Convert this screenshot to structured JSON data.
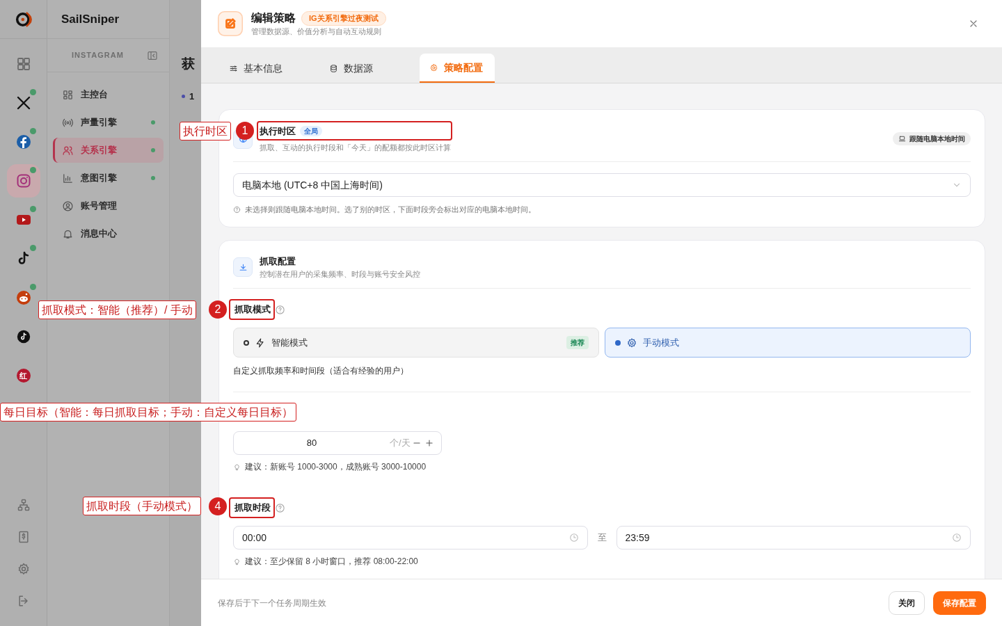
{
  "app": {
    "brand": "SailSniper"
  },
  "platform_rail": [
    {
      "kind": "grid",
      "selected": false,
      "online": false
    },
    {
      "kind": "x",
      "selected": false,
      "online": true
    },
    {
      "kind": "facebook",
      "selected": false,
      "online": true
    },
    {
      "kind": "instagram",
      "selected": true,
      "online": true
    },
    {
      "kind": "youtube",
      "selected": false,
      "online": true
    },
    {
      "kind": "tiktok",
      "selected": false,
      "online": true
    },
    {
      "kind": "reddit",
      "selected": false,
      "online": true
    },
    {
      "kind": "tiktok",
      "selected": false,
      "online": false
    },
    {
      "kind": "badge",
      "label": "红",
      "selected": false,
      "online": false
    }
  ],
  "sidebar": {
    "section": "INSTAGRAM",
    "items": [
      {
        "kind": "dashboard",
        "label": "主控台",
        "selected": false,
        "online": false
      },
      {
        "kind": "signal",
        "label": "声量引擎",
        "selected": false,
        "online": true
      },
      {
        "kind": "users",
        "label": "关系引擎",
        "selected": true,
        "online": true
      },
      {
        "kind": "chart",
        "label": "意图引擎",
        "selected": false,
        "online": true
      },
      {
        "kind": "account",
        "label": "账号管理",
        "selected": false,
        "online": false
      },
      {
        "kind": "bell",
        "label": "消息中心",
        "selected": false,
        "online": false
      }
    ]
  },
  "background_page": {
    "heading": "获",
    "step": "1"
  },
  "drawer": {
    "title": "编辑策略",
    "tag": "IG关系引擎过夜测试",
    "subtitle": "管理数据源、价值分析与自动互动规则",
    "tabs": [
      {
        "kind": "sliders",
        "label": "基本信息",
        "selected": false
      },
      {
        "kind": "database",
        "label": "数据源",
        "selected": false
      },
      {
        "kind": "gear",
        "label": "策略配置",
        "selected": true
      }
    ],
    "timezone_card": {
      "title": "执行时区",
      "scope": "全局",
      "subtitle": "抓取、互动的执行时段和「今天」的配额都按此时区计算",
      "pill": "跟随电脑本地时间",
      "select_value": "电脑本地 (UTC+8 中国上海时间)",
      "help": "未选择则跟随电脑本地时间。选了别的时区，下面时段旁会标出对应的电脑本地时间。"
    },
    "crawl_card": {
      "title": "抓取配置",
      "subtitle": "控制潜在用户的采集频率、时段与账号安全风控",
      "mode_label": "抓取模式",
      "modes": [
        {
          "kind": "smart",
          "label": "智能模式",
          "badge": "推荐",
          "selected": false
        },
        {
          "kind": "manual",
          "label": "手动模式",
          "selected": true
        }
      ],
      "mode_description": "自定义抓取频率和时间段（适合有经验的用户）",
      "daily_target": {
        "value": "80",
        "unit": "个/天",
        "tip": "建议：新账号 1000-3000，成熟账号 3000-10000"
      },
      "period_label": "抓取时段",
      "period_start": "00:00",
      "period_separator": "至",
      "period_end": "23:59",
      "period_tip": "建议：至少保留 8 小时窗口，推荐 08:00-22:00"
    },
    "footer_note": "保存后于下一个任务周期生效",
    "close_button": "关闭",
    "save_button": "保存配置"
  },
  "annotations": [
    {
      "text": "执行时区",
      "number": "1"
    },
    {
      "text": "抓取模式：智能（推荐）/ 手动",
      "number": "2"
    },
    {
      "text": "每日目标（智能：每日抓取目标；手动：自定义每日目标）"
    },
    {
      "text": "抓取时段（手动模式）",
      "number": "4"
    }
  ]
}
